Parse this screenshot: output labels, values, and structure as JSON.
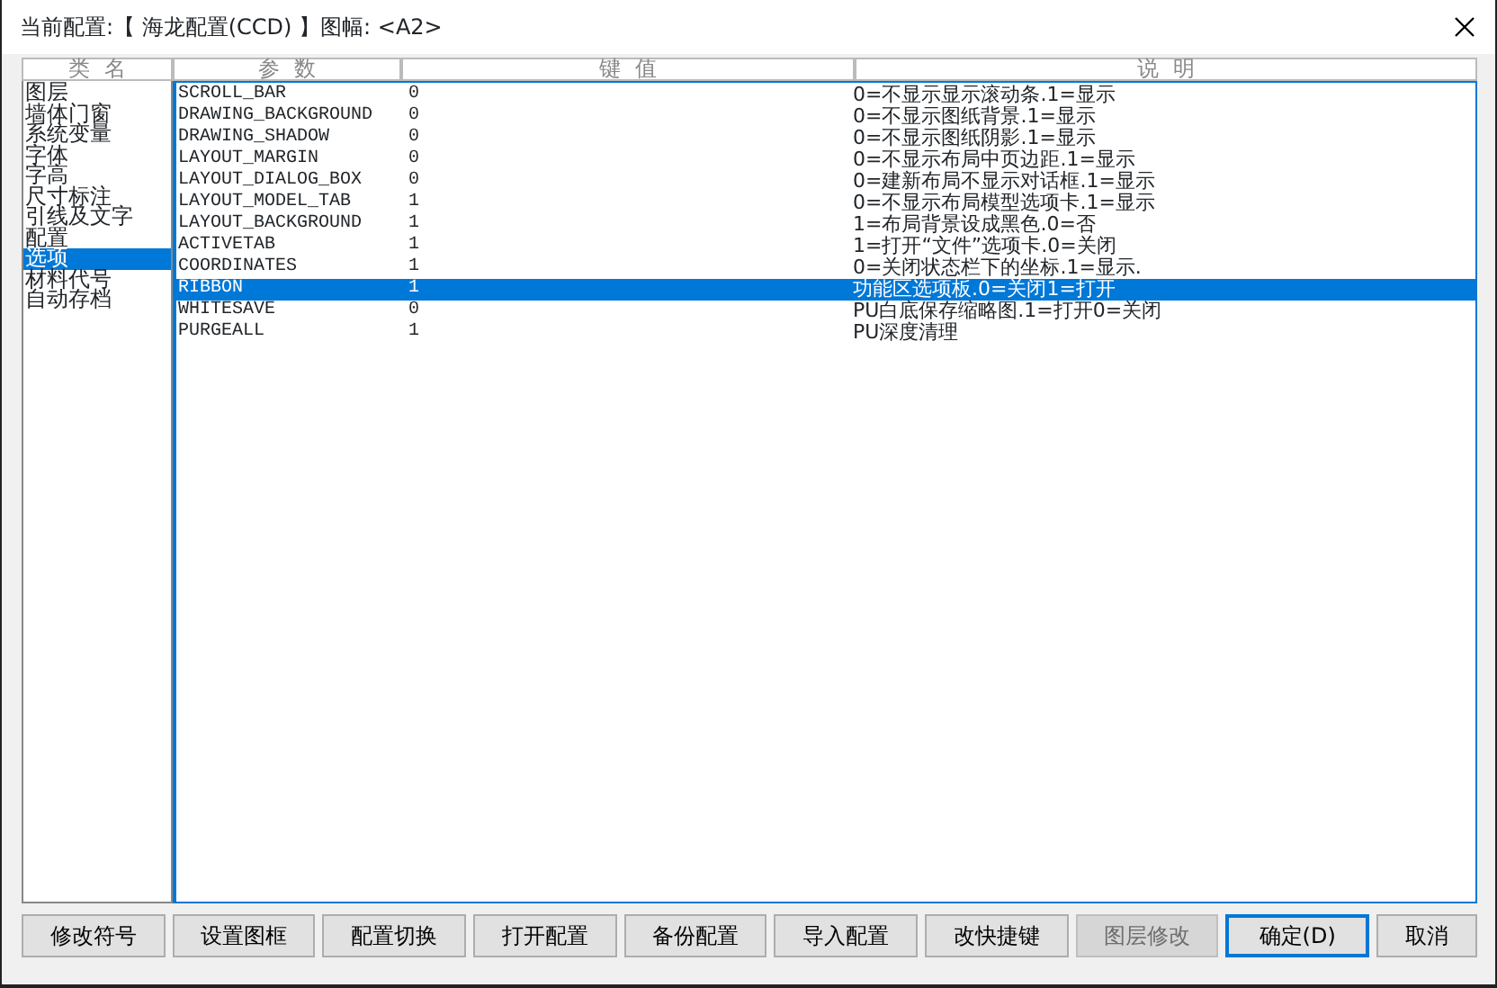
{
  "window": {
    "title": "当前配置:【 海龙配置(CCD) 】图幅: <A2>"
  },
  "category_header": "类  名",
  "categories": [
    {
      "label": "图层",
      "selected": false
    },
    {
      "label": "墙体门窗",
      "selected": false
    },
    {
      "label": "系统变量",
      "selected": false
    },
    {
      "label": "字体",
      "selected": false
    },
    {
      "label": "字高",
      "selected": false
    },
    {
      "label": "尺寸标注",
      "selected": false
    },
    {
      "label": "引线及文字",
      "selected": false
    },
    {
      "label": "配置",
      "selected": false
    },
    {
      "label": "选项",
      "selected": true
    },
    {
      "label": "材料代号",
      "selected": false
    },
    {
      "label": "自动存档",
      "selected": false
    }
  ],
  "table": {
    "columns": [
      "参  数",
      "键  值",
      "说  明"
    ],
    "rows": [
      {
        "param": "SCROLL_BAR",
        "value": "0",
        "description": "0=不显示显示滚动条.1=显示",
        "selected": false
      },
      {
        "param": "DRAWING_BACKGROUND",
        "value": "0",
        "description": "0=不显示图纸背景.1=显示",
        "selected": false
      },
      {
        "param": "DRAWING_SHADOW",
        "value": "0",
        "description": "0=不显示图纸阴影.1=显示",
        "selected": false
      },
      {
        "param": "LAYOUT_MARGIN",
        "value": "0",
        "description": "0=不显示布局中页边距.1=显示",
        "selected": false
      },
      {
        "param": "LAYOUT_DIALOG_BOX",
        "value": "0",
        "description": "0=建新布局不显示对话框.1=显示",
        "selected": false
      },
      {
        "param": "LAYOUT_MODEL_TAB",
        "value": "1",
        "description": "0=不显示布局模型选项卡.1=显示",
        "selected": false
      },
      {
        "param": "LAYOUT_BACKGROUND",
        "value": "1",
        "description": "1=布局背景设成黑色.0=否",
        "selected": false
      },
      {
        "param": "ACTIVETAB",
        "value": "1",
        "description": "1=打开“文件”选项卡.0=关闭",
        "selected": false
      },
      {
        "param": "COORDINATES",
        "value": "1",
        "description": "0=关闭状态栏下的坐标.1=显示.",
        "selected": false
      },
      {
        "param": "RIBBON",
        "value": "1",
        "description": "功能区选项板.0=关闭1=打开",
        "selected": true
      },
      {
        "param": "WHITESAVE",
        "value": "0",
        "description": "PU白底保存缩略图.1=打开0=关闭",
        "selected": false
      },
      {
        "param": "PURGEALL",
        "value": "1",
        "description": "PU深度清理",
        "selected": false
      }
    ]
  },
  "buttons": [
    {
      "label": "修改符号",
      "disabled": false,
      "default": false
    },
    {
      "label": "设置图框",
      "disabled": false,
      "default": false
    },
    {
      "label": "配置切换",
      "disabled": false,
      "default": false
    },
    {
      "label": "打开配置",
      "disabled": false,
      "default": false
    },
    {
      "label": "备份配置",
      "disabled": false,
      "default": false
    },
    {
      "label": "导入配置",
      "disabled": false,
      "default": false
    },
    {
      "label": "改快捷键",
      "disabled": false,
      "default": false
    },
    {
      "label": "图层修改",
      "disabled": true,
      "default": false
    },
    {
      "label": "确定(D)",
      "disabled": false,
      "default": true
    },
    {
      "label": "取消",
      "disabled": false,
      "default": false
    }
  ]
}
